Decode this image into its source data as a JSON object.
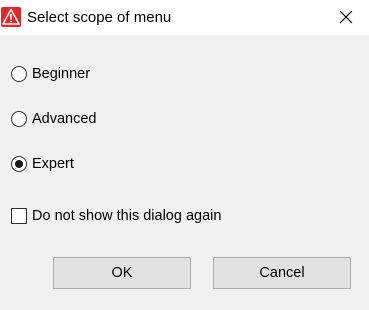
{
  "window": {
    "title": "Select scope of menu",
    "app_icon": "warning-triangle-icon",
    "close_icon": "close-icon"
  },
  "options": [
    {
      "label": "Beginner",
      "checked": false
    },
    {
      "label": "Advanced",
      "checked": false
    },
    {
      "label": "Expert",
      "checked": true
    }
  ],
  "dont_show": {
    "label": "Do not show this dialog again",
    "checked": false
  },
  "buttons": {
    "ok": "OK",
    "cancel": "Cancel"
  },
  "colors": {
    "app_icon_bg": "#e3262a",
    "dialog_bg": "#f0f0f0",
    "button_bg": "#e1e1e1"
  }
}
